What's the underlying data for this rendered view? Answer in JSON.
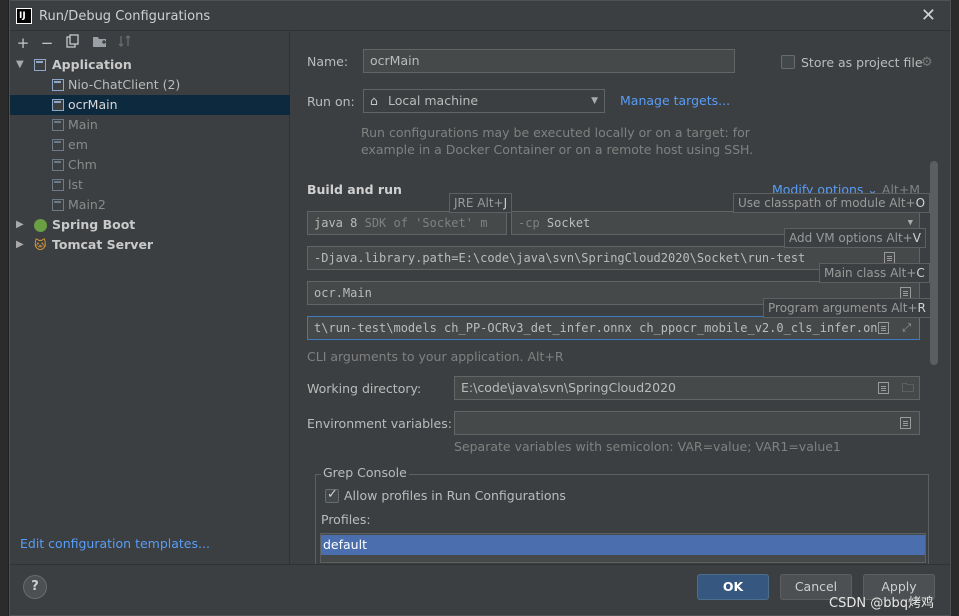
{
  "window": {
    "title": "Run/Debug Configurations",
    "app_icon": "IJ"
  },
  "toolbar": {
    "add_icon": "+",
    "remove_icon": "−",
    "copy_icon": "copy-icon",
    "folder_icon": "new-folder-icon",
    "sort_icon": "sort-icon"
  },
  "tree": {
    "application": "Application",
    "items": [
      {
        "label": "Nio-ChatClient (2)",
        "dim": false
      },
      {
        "label": "ocrMain",
        "dim": false,
        "selected": true
      },
      {
        "label": "Main",
        "dim": true
      },
      {
        "label": "em",
        "dim": true
      },
      {
        "label": "Chm",
        "dim": true
      },
      {
        "label": "lst",
        "dim": true
      },
      {
        "label": "Main2",
        "dim": true
      }
    ],
    "spring_boot": "Spring Boot",
    "tomcat": "Tomcat Server"
  },
  "left_footer": {
    "edit_templates": "Edit configuration templates..."
  },
  "form": {
    "name_label": "Name:",
    "name_value": "ocrMain",
    "store_project_file": "Store as project file",
    "run_on_label": "Run on:",
    "run_on_value": "Local machine",
    "manage_targets": "Manage targets...",
    "run_on_hint_1": "Run configurations may be executed locally or on a target: for",
    "run_on_hint_2": "example in a Docker Container or on a remote host using SSH.",
    "build_run_title": "Build and run",
    "modify_options": "Modify options",
    "modify_options_shortcut": "Alt+M",
    "jre_value": "java 8",
    "jre_hint": "SDK of 'Socket' m",
    "cp_flag": "-cp",
    "cp_value": "Socket",
    "vm_options": "-Djava.library.path=E:\\code\\java\\svn\\SpringCloud2020\\Socket\\run-test",
    "main_class": "ocr.Main",
    "program_args": "t\\run-test\\models  ch_PP-OCRv3_det_infer.onnx  ch_ppocr_mobile_v2.0_cls_infer.on",
    "cli_hint": "CLI arguments to your application. Alt+R",
    "working_dir_label": "Working directory:",
    "working_dir_value": "E:\\code\\java\\svn\\SpringCloud2020",
    "env_label": "Environment variables:",
    "env_value": "",
    "env_hint": "Separate variables with semicolon: VAR=value; VAR1=value1"
  },
  "tooltips": {
    "jre": {
      "text": "JRE Alt+",
      "key": "J"
    },
    "classpath": {
      "text": "Use classpath of module Alt+",
      "key": "O"
    },
    "vm": {
      "text": "Add VM options Alt+",
      "key": "V"
    },
    "main": {
      "text": "Main class Alt+",
      "key": "C"
    },
    "args": {
      "text": "Program arguments Alt+",
      "key": "R"
    }
  },
  "grep": {
    "title": "Grep Console",
    "allow_profiles": "Allow profiles in Run Configurations",
    "profiles_label": "Profiles:",
    "profile_default": "default"
  },
  "buttons": {
    "help": "?",
    "ok": "OK",
    "cancel": "Cancel",
    "apply": "Apply"
  },
  "watermark": "CSDN @bbq烤鸡",
  "colors": {
    "background": "#3c3f41",
    "selection": "#0d293e",
    "link": "#589df6",
    "primary_button": "#365880",
    "list_selection": "#4b6eaf"
  }
}
